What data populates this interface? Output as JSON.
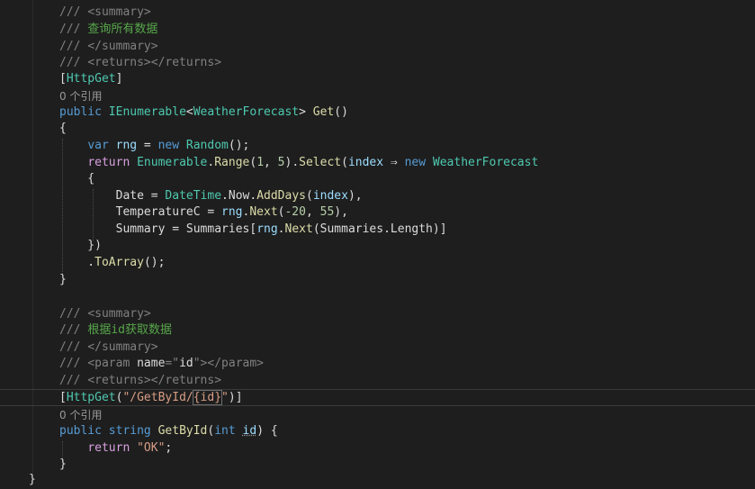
{
  "editor": {
    "lines": [
      [
        {
          "t": "/// ",
          "c": "c-tag"
        },
        {
          "t": "<summary>",
          "c": "c-tag"
        }
      ],
      [
        {
          "t": "/// ",
          "c": "c-tag"
        },
        {
          "t": "查询所有数据",
          "c": "c-com"
        }
      ],
      [
        {
          "t": "/// ",
          "c": "c-tag"
        },
        {
          "t": "</summary>",
          "c": "c-tag"
        }
      ],
      [
        {
          "t": "/// ",
          "c": "c-tag"
        },
        {
          "t": "<returns></returns>",
          "c": "c-tag"
        }
      ],
      [
        {
          "t": "[",
          "c": "c-pl"
        },
        {
          "t": "HttpGet",
          "c": "c-typ"
        },
        {
          "t": "]",
          "c": "c-pl"
        }
      ],
      [
        {
          "t": "0 个引用",
          "c": "lens"
        }
      ],
      [
        {
          "t": "public ",
          "c": "c-kw"
        },
        {
          "t": "IEnumerable",
          "c": "c-typ"
        },
        {
          "t": "<",
          "c": "c-pl"
        },
        {
          "t": "WeatherForecast",
          "c": "c-typ"
        },
        {
          "t": "> ",
          "c": "c-pl"
        },
        {
          "t": "Get",
          "c": "c-mth"
        },
        {
          "t": "()",
          "c": "c-pl"
        }
      ],
      [
        {
          "t": "{",
          "c": "c-pl"
        }
      ],
      [
        {
          "t": "    ",
          "c": "c-pl"
        },
        {
          "t": "var ",
          "c": "c-kw"
        },
        {
          "t": "rng",
          "c": "c-var"
        },
        {
          "t": " = ",
          "c": "c-pl"
        },
        {
          "t": "new ",
          "c": "c-kw"
        },
        {
          "t": "Random",
          "c": "c-typ"
        },
        {
          "t": "();",
          "c": "c-pl"
        }
      ],
      [
        {
          "t": "    ",
          "c": "c-pl"
        },
        {
          "t": "return ",
          "c": "c-ctl"
        },
        {
          "t": "Enumerable",
          "c": "c-typ"
        },
        {
          "t": ".",
          "c": "c-pl"
        },
        {
          "t": "Range",
          "c": "c-mth"
        },
        {
          "t": "(",
          "c": "c-pl"
        },
        {
          "t": "1",
          "c": "c-num"
        },
        {
          "t": ", ",
          "c": "c-pl"
        },
        {
          "t": "5",
          "c": "c-num"
        },
        {
          "t": ").",
          "c": "c-pl"
        },
        {
          "t": "Select",
          "c": "c-mth"
        },
        {
          "t": "(",
          "c": "c-pl"
        },
        {
          "t": "index",
          "c": "c-var"
        },
        {
          "t": " ⇒ ",
          "c": "c-pl"
        },
        {
          "t": "new ",
          "c": "c-kw"
        },
        {
          "t": "WeatherForecast",
          "c": "c-typ"
        }
      ],
      [
        {
          "t": "    {",
          "c": "c-pl"
        }
      ],
      [
        {
          "t": "        ",
          "c": "c-pl"
        },
        {
          "t": "Date",
          "c": "c-pl"
        },
        {
          "t": " = ",
          "c": "c-pl"
        },
        {
          "t": "DateTime",
          "c": "c-typ"
        },
        {
          "t": ".",
          "c": "c-pl"
        },
        {
          "t": "Now",
          "c": "c-pl"
        },
        {
          "t": ".",
          "c": "c-pl"
        },
        {
          "t": "AddDays",
          "c": "c-mth"
        },
        {
          "t": "(",
          "c": "c-pl"
        },
        {
          "t": "index",
          "c": "c-var"
        },
        {
          "t": "),",
          "c": "c-pl"
        }
      ],
      [
        {
          "t": "        ",
          "c": "c-pl"
        },
        {
          "t": "TemperatureC",
          "c": "c-pl"
        },
        {
          "t": " = ",
          "c": "c-pl"
        },
        {
          "t": "rng",
          "c": "c-var"
        },
        {
          "t": ".",
          "c": "c-pl"
        },
        {
          "t": "Next",
          "c": "c-mth"
        },
        {
          "t": "(",
          "c": "c-pl"
        },
        {
          "t": "-20",
          "c": "c-num"
        },
        {
          "t": ", ",
          "c": "c-pl"
        },
        {
          "t": "55",
          "c": "c-num"
        },
        {
          "t": "),",
          "c": "c-pl"
        }
      ],
      [
        {
          "t": "        ",
          "c": "c-pl"
        },
        {
          "t": "Summary",
          "c": "c-pl"
        },
        {
          "t": " = ",
          "c": "c-pl"
        },
        {
          "t": "Summaries",
          "c": "c-pl"
        },
        {
          "t": "[",
          "c": "c-pl"
        },
        {
          "t": "rng",
          "c": "c-var"
        },
        {
          "t": ".",
          "c": "c-pl"
        },
        {
          "t": "Next",
          "c": "c-mth"
        },
        {
          "t": "(",
          "c": "c-pl"
        },
        {
          "t": "Summaries",
          "c": "c-pl"
        },
        {
          "t": ".",
          "c": "c-pl"
        },
        {
          "t": "Length",
          "c": "c-pl"
        },
        {
          "t": ")]",
          "c": "c-pl"
        }
      ],
      [
        {
          "t": "    })",
          "c": "c-pl"
        }
      ],
      [
        {
          "t": "    .",
          "c": "c-pl"
        },
        {
          "t": "ToArray",
          "c": "c-mth"
        },
        {
          "t": "();",
          "c": "c-pl"
        }
      ],
      [
        {
          "t": "}",
          "c": "c-pl"
        }
      ],
      [],
      [
        {
          "t": "/// ",
          "c": "c-tag"
        },
        {
          "t": "<summary>",
          "c": "c-tag"
        }
      ],
      [
        {
          "t": "/// ",
          "c": "c-tag"
        },
        {
          "t": "根据id获取数据",
          "c": "c-com"
        }
      ],
      [
        {
          "t": "/// ",
          "c": "c-tag"
        },
        {
          "t": "</summary>",
          "c": "c-tag"
        }
      ],
      [
        {
          "t": "/// ",
          "c": "c-tag"
        },
        {
          "t": "<param ",
          "c": "c-tag"
        },
        {
          "t": "name",
          "c": "c-pl"
        },
        {
          "t": "=\"",
          "c": "c-tag"
        },
        {
          "t": "id",
          "c": "c-pl"
        },
        {
          "t": "\"></param>",
          "c": "c-tag"
        }
      ],
      [
        {
          "t": "/// ",
          "c": "c-tag"
        },
        {
          "t": "<returns></returns>",
          "c": "c-tag"
        }
      ],
      [
        {
          "t": "[",
          "c": "c-pl"
        },
        {
          "t": "HttpGet",
          "c": "c-typ"
        },
        {
          "t": "(",
          "c": "c-pl"
        },
        {
          "t": "\"/GetById/",
          "c": "c-str"
        },
        {
          "t": "{id}",
          "c": "c-str boxed"
        },
        {
          "t": "\"",
          "c": "c-str"
        },
        {
          "t": ")]",
          "c": "c-pl"
        }
      ],
      [
        {
          "t": "0 个引用",
          "c": "lens"
        }
      ],
      [
        {
          "t": "public ",
          "c": "c-kw"
        },
        {
          "t": "string ",
          "c": "c-kw"
        },
        {
          "t": "GetById",
          "c": "c-mth"
        },
        {
          "t": "(",
          "c": "c-pl"
        },
        {
          "t": "int ",
          "c": "c-kw"
        },
        {
          "t": "id",
          "c": "c-var squig"
        },
        {
          "t": ") {",
          "c": "c-pl"
        }
      ],
      [
        {
          "t": "    ",
          "c": "c-pl"
        },
        {
          "t": "return ",
          "c": "c-ctl"
        },
        {
          "t": "\"OK\"",
          "c": "c-str"
        },
        {
          "t": ";",
          "c": "c-pl"
        }
      ],
      [
        {
          "t": "}",
          "c": "c-pl"
        }
      ],
      [
        {
          "t": "}",
          "c": "c-pl"
        }
      ]
    ]
  }
}
